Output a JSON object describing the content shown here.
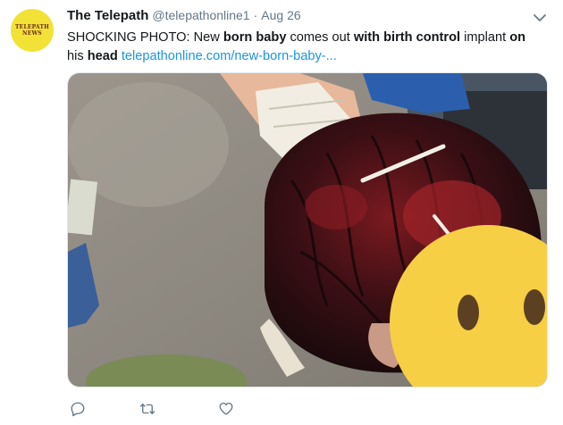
{
  "tweet": {
    "author": {
      "display_name": "The Telepath",
      "handle": "@telepathonline1",
      "separator": "·",
      "date": "Aug 26",
      "avatar_line1": "TELEPATH",
      "avatar_line2": "NEWS",
      "avatar_color": "#f2e236"
    },
    "text": {
      "part1": "SHOCKING PHOTO: New ",
      "bold1": "born baby",
      "part2": " comes out ",
      "bold2": "with birth control",
      "part3": " implant ",
      "bold3": "on",
      "part4": " his ",
      "bold4": "head",
      "part5": " ",
      "link": "telepathonline.com/new-born-baby-..."
    },
    "media": {
      "icon": "photo-newborn-with-implant"
    },
    "actions": {
      "reply_icon": "reply-icon",
      "retweet_icon": "retweet-icon",
      "like_icon": "heart-icon"
    },
    "colors": {
      "link": "#1b95e0",
      "muted": "#657786",
      "text": "#14171a"
    }
  }
}
